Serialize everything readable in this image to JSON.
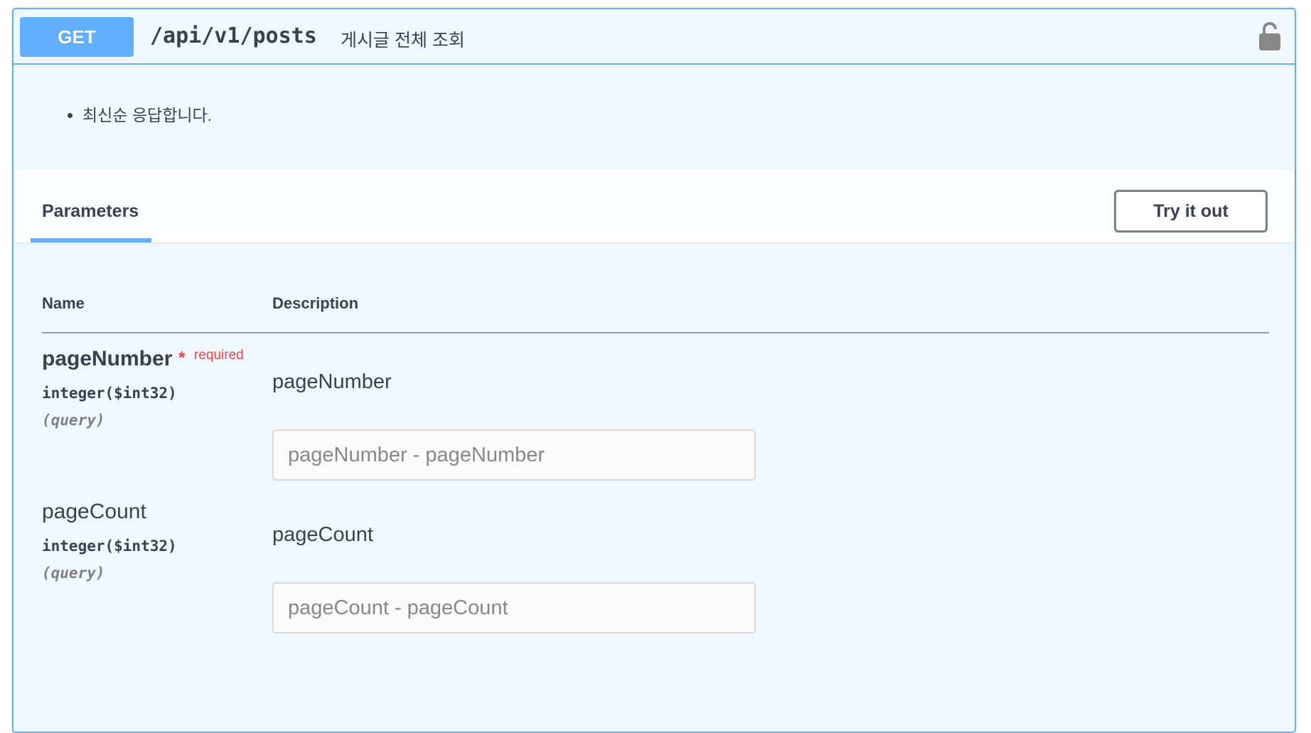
{
  "summary": {
    "method": "GET",
    "path": "/api/v1/posts",
    "description": "게시글 전체 조회",
    "lock_icon": "lock-open-icon"
  },
  "description": {
    "items": [
      "최신순 응답합니다."
    ]
  },
  "tabs": {
    "parameters": "Parameters",
    "try_it_out": "Try it out"
  },
  "table": {
    "name_header": "Name",
    "description_header": "Description"
  },
  "parameters": [
    {
      "name": "pageNumber",
      "required_star": "*",
      "required_label": "required",
      "type": "integer($int32)",
      "in": "(query)",
      "description": "pageNumber",
      "placeholder": "pageNumber - pageNumber"
    },
    {
      "name": "pageCount",
      "type": "integer($int32)",
      "in": "(query)",
      "description": "pageCount",
      "placeholder": "pageCount - pageCount"
    }
  ],
  "colors": {
    "get_accent": "#61affe",
    "required": "#f93e3e",
    "text": "#3b4151"
  }
}
